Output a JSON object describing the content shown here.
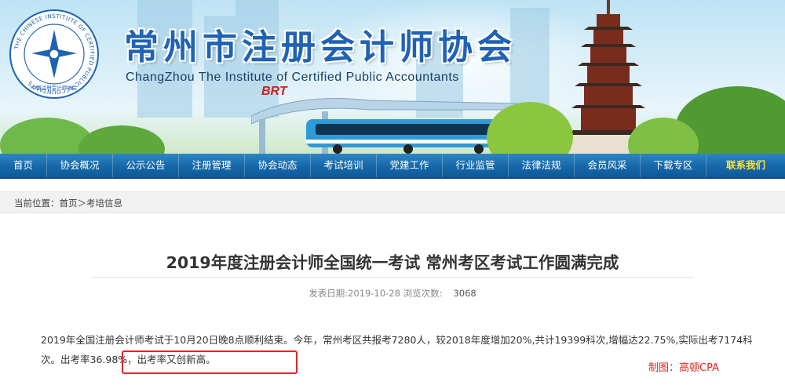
{
  "header": {
    "title_cn": "常州市注册会计师协会",
    "title_en": "ChangZhou The Institute of Certified Public Accountants",
    "logo_ring_text": "THE CHINESE INSTITUTE OF CERTIFIED PUBLIC ACCOUNTANTS",
    "logo_cn_text": "中国注册会计师协会",
    "brt_text": "BRT",
    "logo_icon": "cicpa-emblem-icon"
  },
  "nav": {
    "items": [
      {
        "label": "首页"
      },
      {
        "label": "协会概况"
      },
      {
        "label": "公示公告"
      },
      {
        "label": "注册管理"
      },
      {
        "label": "协会动态"
      },
      {
        "label": "考试培训"
      },
      {
        "label": "党建工作"
      },
      {
        "label": "行业监管"
      },
      {
        "label": "法律法规"
      },
      {
        "label": "会员风采"
      },
      {
        "label": "下载专区"
      },
      {
        "label": "联系我们"
      }
    ],
    "highlight_color": "#ffe03a",
    "bg_color": "#1667a9"
  },
  "breadcrumb": {
    "prefix": "当前位置：",
    "home": "首页",
    "sep": "＞",
    "current": "考培信息"
  },
  "article": {
    "title": "2019年度注册会计师全国统一考试 常州考区考试工作圆满完成",
    "publish_label": "发表日期:",
    "publish_date": "2019-10-28",
    "views_label": "浏览次数:",
    "views": "3068",
    "paragraph": "2019年全国注册会计师考试于10月20日晚8点顺利结束。今年，常州考区共报考7280人，较2018年度增加20%,共计19399科次,增幅达22.75%,实际出考7174科次。出考率36.98%，出考率又创新高。",
    "credit": "制图：高顿CPA",
    "highlight_color": "#e02424"
  }
}
